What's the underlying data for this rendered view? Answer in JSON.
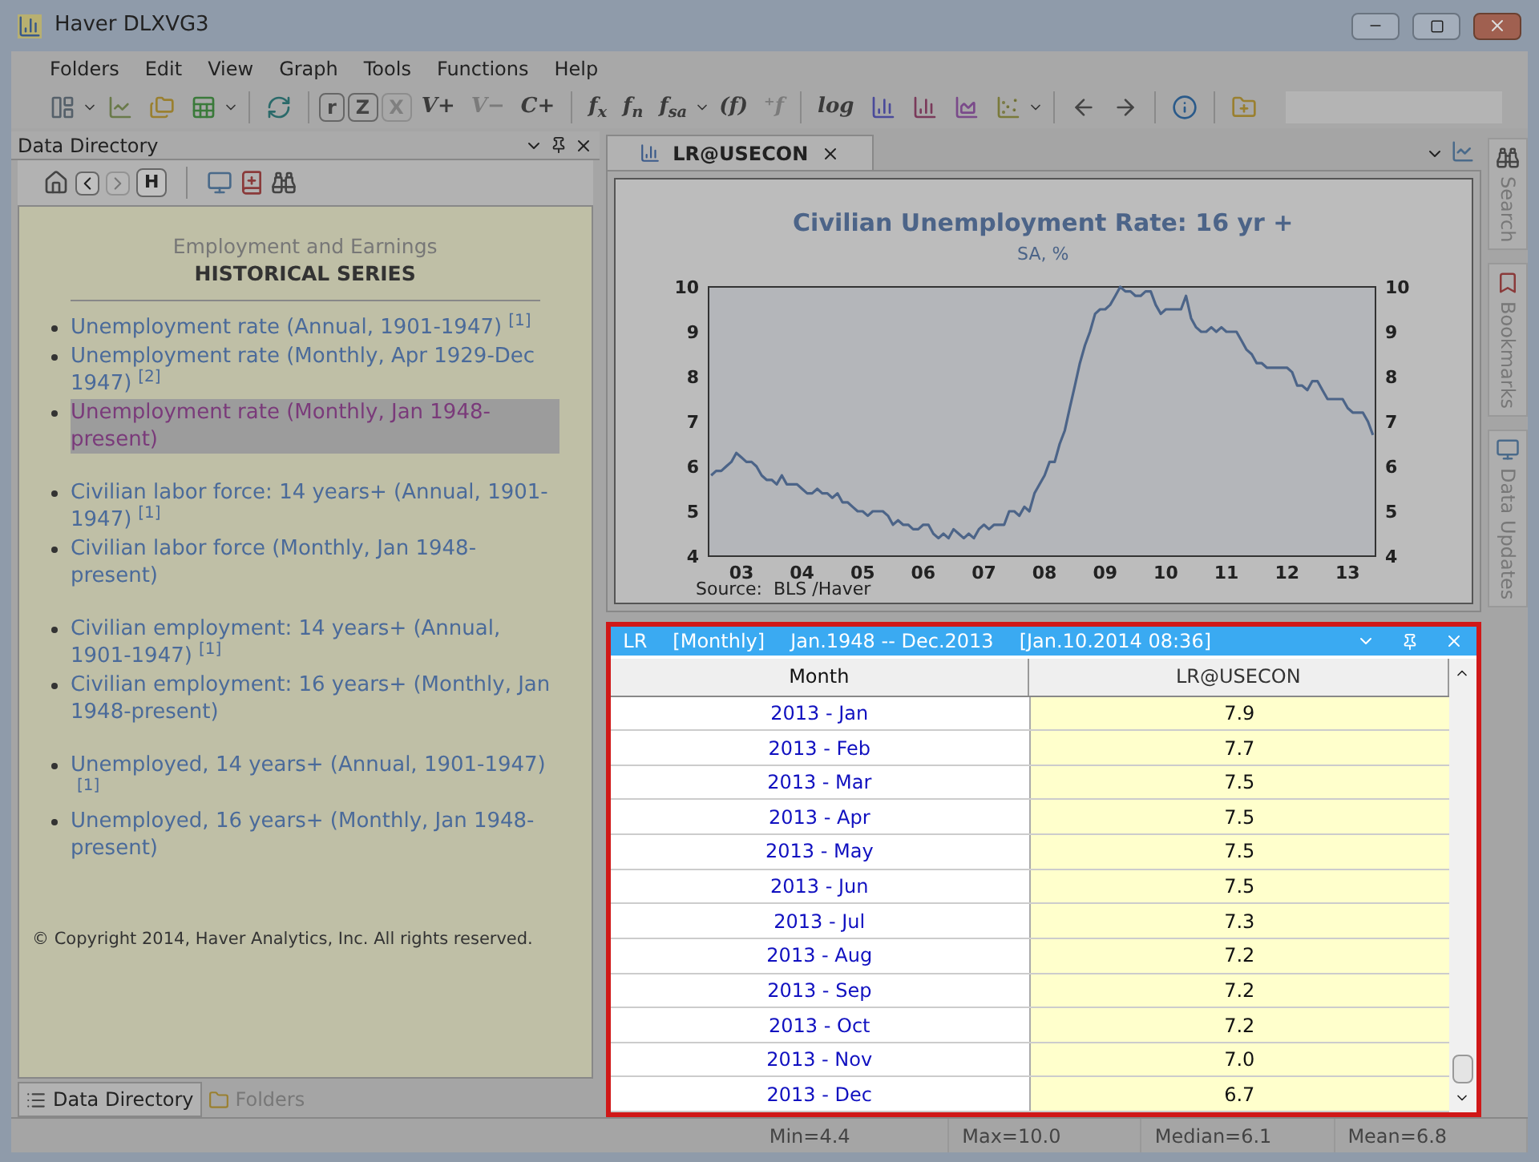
{
  "window": {
    "title": "Haver DLXVG3"
  },
  "menu": [
    "Folders",
    "Edit",
    "View",
    "Graph",
    "Tools",
    "Functions",
    "Help"
  ],
  "toolbar": [
    {
      "kind": "layout",
      "dropdown": true,
      "disabled": false
    },
    {
      "kind": "linechart",
      "dropdown": false,
      "disabled": false
    },
    {
      "kind": "folders",
      "dropdown": false,
      "disabled": false
    },
    {
      "kind": "spreadsheet",
      "dropdown": true,
      "disabled": false
    },
    {
      "kind": "separator"
    },
    {
      "kind": "refresh",
      "dropdown": false,
      "disabled": false
    },
    {
      "kind": "separator"
    },
    {
      "kind": "boxed",
      "label": "r",
      "dropdown": false,
      "disabled": false
    },
    {
      "kind": "boxed",
      "label": "Z",
      "dropdown": false,
      "disabled": false
    },
    {
      "kind": "boxed",
      "label": "X",
      "dropdown": false,
      "disabled": true
    },
    {
      "kind": "text",
      "label": "V+",
      "dropdown": false,
      "disabled": false
    },
    {
      "kind": "text",
      "label": "V−",
      "dropdown": false,
      "disabled": true
    },
    {
      "kind": "text",
      "label": "C+",
      "dropdown": false,
      "disabled": false
    },
    {
      "kind": "separator"
    },
    {
      "kind": "text",
      "label": "f$_{x}$",
      "dropdown": false,
      "disabled": false
    },
    {
      "kind": "text",
      "label": "f$_{n}$",
      "dropdown": false,
      "disabled": false
    },
    {
      "kind": "text",
      "label": "f$_{sa}$",
      "dropdown": true,
      "disabled": false
    },
    {
      "kind": "text",
      "label": "(f)",
      "dropdown": false,
      "disabled": false
    },
    {
      "kind": "text",
      "label": "⁺f",
      "dropdown": false,
      "disabled": true
    },
    {
      "kind": "separator"
    },
    {
      "kind": "text",
      "label": "log",
      "dropdown": false,
      "disabled": false
    },
    {
      "kind": "barchart",
      "dropdown": false,
      "disabled": false
    },
    {
      "kind": "columnchart",
      "dropdown": false,
      "disabled": false
    },
    {
      "kind": "areachart",
      "dropdown": false,
      "disabled": false
    },
    {
      "kind": "scatter",
      "dropdown": true,
      "disabled": false
    },
    {
      "kind": "separator"
    },
    {
      "kind": "back",
      "dropdown": false,
      "disabled": false
    },
    {
      "kind": "forward",
      "dropdown": false,
      "disabled": false
    },
    {
      "kind": "separator"
    },
    {
      "kind": "info",
      "dropdown": false,
      "disabled": false
    },
    {
      "kind": "separator"
    },
    {
      "kind": "folderadd",
      "dropdown": false,
      "disabled": false
    }
  ],
  "data_directory": {
    "title": "Data Directory",
    "toolbar": [
      {
        "kind": "home",
        "disabled": false
      },
      {
        "kind": "back",
        "disabled": false
      },
      {
        "kind": "forward",
        "disabled": true
      },
      {
        "kind": "boxed",
        "label": "H",
        "disabled": false
      },
      {
        "kind": "separator"
      },
      {
        "kind": "monitor",
        "disabled": false
      },
      {
        "kind": "bookadd",
        "disabled": false
      },
      {
        "kind": "binoculars",
        "disabled": false
      }
    ],
    "subtitle": "Employment and Earnings",
    "heading": "HISTORICAL SERIES",
    "groups": [
      [
        {
          "text": "Unemployment rate (Annual, 1901-1947)",
          "note": "[1]",
          "selected": false
        },
        {
          "text": "Unemployment rate (Monthly, Apr 1929-Dec 1947)",
          "note": "[2]",
          "selected": false
        },
        {
          "text": "Unemployment rate (Monthly, Jan 1948-present)",
          "selected": true
        }
      ],
      [
        {
          "text": "Civilian labor force: 14 years+ (Annual, 1901-1947)",
          "note": "[1]",
          "selected": false
        },
        {
          "text": "Civilian labor force (Monthly, Jan 1948-present)",
          "selected": false
        }
      ],
      [
        {
          "text": "Civilian employment: 14 years+ (Annual, 1901-1947)",
          "note": "[1]",
          "selected": false
        },
        {
          "text": "Civilian employment: 16 years+ (Monthly, Jan 1948-present)",
          "selected": false
        }
      ],
      [
        {
          "text": "Unemployed, 14 years+ (Annual, 1901-1947)",
          "note": "[1]",
          "selected": false
        },
        {
          "text": "Unemployed, 16 years+ (Monthly, Jan 1948-present)",
          "selected": false
        }
      ]
    ],
    "copyright": "© Copyright 2014, Haver Analytics, Inc. All rights reserved.",
    "tabs": [
      {
        "label": "Data Directory",
        "kind": "list",
        "selected": true
      },
      {
        "label": "Folders",
        "kind": "folders",
        "selected": false
      }
    ]
  },
  "document_tab": {
    "label": "LR@USECON"
  },
  "chart": {
    "chart_data": {
      "type": "line",
      "title": "Civilian Unemployment Rate: 16 yr +",
      "ylabel": "SA, %",
      "categories": [
        null,
        null,
        null,
        null,
        null,
        null,
        "03",
        null,
        null,
        null,
        null,
        null,
        null,
        null,
        null,
        null,
        null,
        null,
        "04",
        null,
        null,
        null,
        null,
        null,
        null,
        null,
        null,
        null,
        null,
        null,
        "05",
        null,
        null,
        null,
        null,
        null,
        null,
        null,
        null,
        null,
        null,
        null,
        "06",
        null,
        null,
        null,
        null,
        null,
        null,
        null,
        null,
        null,
        null,
        null,
        "07",
        null,
        null,
        null,
        null,
        null,
        null,
        null,
        null,
        null,
        null,
        null,
        "08",
        null,
        null,
        null,
        null,
        null,
        null,
        null,
        null,
        null,
        null,
        null,
        "09",
        null,
        null,
        null,
        null,
        null,
        null,
        null,
        null,
        null,
        null,
        null,
        "10",
        null,
        null,
        null,
        null,
        null,
        null,
        null,
        null,
        null,
        null,
        null,
        "11",
        null,
        null,
        null,
        null,
        null,
        null,
        null,
        null,
        null,
        null,
        null,
        "12",
        null,
        null,
        null,
        null,
        null,
        null,
        null,
        null,
        null,
        null,
        null,
        "13",
        null,
        null,
        null,
        null,
        null
      ],
      "series": [
        {
          "color": "#4c6488",
          "values": [
            5.8,
            5.9,
            5.9,
            6.0,
            6.1,
            6.3,
            6.2,
            6.1,
            6.1,
            6.0,
            5.8,
            5.7,
            5.7,
            5.6,
            5.8,
            5.6,
            5.6,
            5.6,
            5.5,
            5.4,
            5.4,
            5.5,
            5.4,
            5.4,
            5.3,
            5.4,
            5.2,
            5.2,
            5.1,
            5.0,
            5.0,
            4.9,
            5.0,
            5.0,
            5.0,
            4.9,
            4.7,
            4.8,
            4.7,
            4.7,
            4.6,
            4.6,
            4.7,
            4.7,
            4.5,
            4.4,
            4.5,
            4.4,
            4.6,
            4.5,
            4.4,
            4.5,
            4.4,
            4.6,
            4.7,
            4.6,
            4.7,
            4.7,
            4.7,
            5.0,
            5.0,
            4.9,
            5.1,
            5.0,
            5.4,
            5.6,
            5.8,
            6.1,
            6.1,
            6.5,
            6.8,
            7.3,
            7.8,
            8.3,
            8.7,
            9.0,
            9.4,
            9.5,
            9.5,
            9.6,
            9.8,
            10.0,
            9.9,
            9.9,
            9.8,
            9.8,
            9.9,
            9.9,
            9.6,
            9.4,
            9.5,
            9.5,
            9.5,
            9.5,
            9.8,
            9.3,
            9.1,
            9.0,
            9.0,
            9.1,
            9.0,
            9.1,
            9.0,
            9.0,
            9.0,
            8.8,
            8.6,
            8.5,
            8.3,
            8.3,
            8.2,
            8.2,
            8.2,
            8.2,
            8.2,
            8.1,
            7.8,
            7.8,
            7.7,
            7.9,
            7.9,
            7.7,
            7.5,
            7.5,
            7.5,
            7.5,
            7.3,
            7.2,
            7.2,
            7.2,
            7.0,
            6.7
          ]
        }
      ],
      "ylim": [
        4,
        10
      ],
      "yticks": [
        {
          "value": 10,
          "label": "10"
        },
        {
          "value": 9,
          "label": "9"
        },
        {
          "value": 8,
          "label": "8"
        },
        {
          "value": 7,
          "label": "7"
        },
        {
          "value": 6,
          "label": "6"
        },
        {
          "value": 5,
          "label": "5"
        },
        {
          "value": 4,
          "label": "4"
        }
      ],
      "annotations": [
        "Source:  BLS /Haver"
      ]
    },
    "right_axis_labels": [
      "10",
      "9",
      "8",
      "7",
      "6",
      "5",
      "4"
    ]
  },
  "data_panel": {
    "header": [
      "LR",
      "[Monthly]",
      "Jan.1948 -- Dec.2013",
      "[Jan.10.2014 08:36]"
    ],
    "columns": [
      "Month",
      "LR@USECON"
    ],
    "rows": [
      [
        "2013 - Jan",
        "7.9"
      ],
      [
        "2013 - Feb",
        "7.7"
      ],
      [
        "2013 - Mar",
        "7.5"
      ],
      [
        "2013 - Apr",
        "7.5"
      ],
      [
        "2013 - May",
        "7.5"
      ],
      [
        "2013 - Jun",
        "7.5"
      ],
      [
        "2013 - Jul",
        "7.3"
      ],
      [
        "2013 - Aug",
        "7.2"
      ],
      [
        "2013 - Sep",
        "7.2"
      ],
      [
        "2013 - Oct",
        "7.2"
      ],
      [
        "2013 - Nov",
        "7.0"
      ],
      [
        "2013 - Dec",
        "6.7"
      ]
    ]
  },
  "side_tabs": [
    {
      "label": "Search",
      "kind": "binoculars"
    },
    {
      "label": "Bookmarks",
      "kind": "bookmark"
    },
    {
      "label": "Data Updates",
      "kind": "monitor"
    }
  ],
  "status_bar": [
    "Min=4.4",
    "Max=10.0",
    "Median=6.1",
    "Mean=6.8"
  ]
}
